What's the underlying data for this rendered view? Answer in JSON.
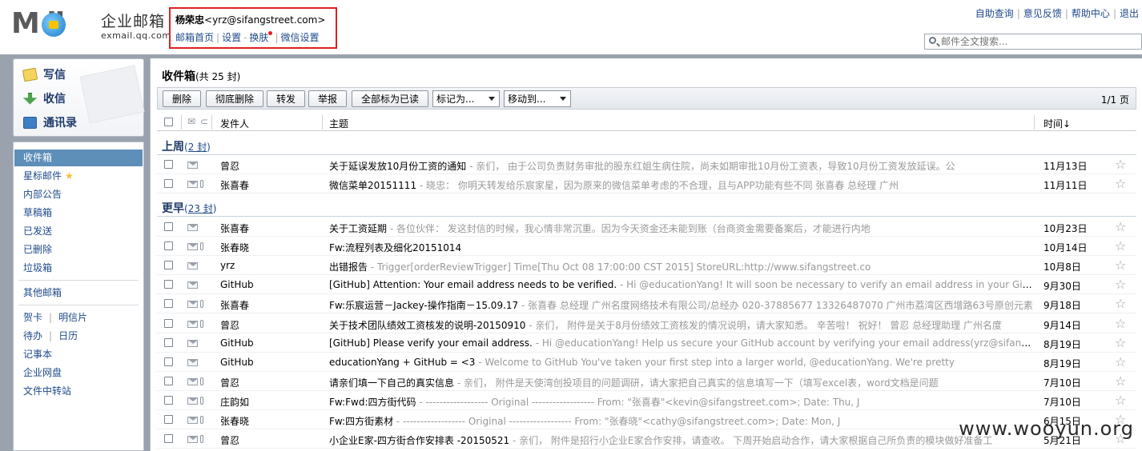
{
  "brand": {
    "logo_word": "M  il",
    "logo_cn": "企业邮箱",
    "logo_en": "exmail.qq.com"
  },
  "user": {
    "name": "杨荣忠",
    "email": "<yrz@sifangstreet.com>",
    "links": [
      "邮箱首页",
      "设置",
      "换肤",
      "微信设置"
    ]
  },
  "toplinks": [
    "自助查询",
    "意见反馈",
    "帮助中心",
    "退出"
  ],
  "search": {
    "placeholder": "邮件全文搜索..."
  },
  "actions": {
    "write": "写信",
    "receive": "收信",
    "contacts": "通讯录"
  },
  "folders": {
    "inbox": "收件箱",
    "starred": "星标邮件",
    "notice": "内部公告",
    "drafts": "草稿箱",
    "sent": "已发送",
    "deleted": "已删除",
    "spam": "垃圾箱",
    "other": "其他邮箱",
    "card": "贺卡",
    "postcard": "明信片",
    "todo": "待办",
    "calendar": "日历",
    "notes": "记事本",
    "disk": "企业网盘",
    "transfer": "文件中转站"
  },
  "main": {
    "title": "收件箱",
    "count": "(共 25 封)",
    "page": "1/1 页",
    "buttons": [
      "删除",
      "彻底删除",
      "转发",
      "举报",
      "全部标为已读"
    ],
    "mark_as": "标记为...",
    "move_to": "移动到...",
    "col_sender": "发件人",
    "col_subject": "主题",
    "col_time": "时间↓"
  },
  "groups": {
    "last_week": {
      "label": "上周",
      "count_open": "(",
      "count": "2 封",
      "count_close": ")"
    },
    "earlier": {
      "label": "更早",
      "count_open": "(",
      "count": "23 封",
      "count_close": ")"
    }
  },
  "mails_last_week": [
    {
      "sender": "曾忍",
      "subject": "关于延误发放10月份工资的通知",
      "snippet": " - 亲们， 由于公司负责财务审批的股东红姐生病住院，尚未如期审批10月份工资表，导致10月份工资发放延误。公",
      "date": "11月13日",
      "attach": false
    },
    {
      "sender": "张喜春",
      "subject": "微信菜单20151111",
      "snippet": " - 晓忠： 你明天转发给乐宸家星，因为原来的微信菜单考虑的不合理，且与APP功能有些不同 张喜春 总经理 广州",
      "date": "11月11日",
      "attach": true
    }
  ],
  "mails_earlier": [
    {
      "sender": "张喜春",
      "subject": "关于工资延期",
      "snippet": " - 各位伙伴： 发这封信的时候，我心情非常沉重。因为今天资金还未能到账（台商资金需要备案后，才能进行内地",
      "date": "10月23日",
      "attach": false
    },
    {
      "sender": "张春晓",
      "subject": "Fw:流程列表及细化20151014",
      "snippet": "",
      "date": "10月14日",
      "attach": true
    },
    {
      "sender": "yrz",
      "subject": "出错报告",
      "snippet": " - Trigger[orderReviewTrigger] Time[Thu Oct 08 17:00:00 CST 2015] StoreURL:http://www.sifangstreet.co",
      "date": "10月8日",
      "attach": false
    },
    {
      "sender": "GitHub",
      "subject": "[GitHub] Attention: Your email address needs to be verified.",
      "snippet": " - Hi @educationYang! It will soon be necessary to verify an email address in your GitHub account",
      "date": "9月30日",
      "attach": false
    },
    {
      "sender": "张喜春",
      "subject": "Fw:乐宸运营－Jackey-操作指南－15.09.17",
      "snippet": " - 张喜春 总经理 广州名度网络技术有限公司/总经办 020-37885677 13326487070 广州市荔湾区西增路63号原创元素",
      "date": "9月18日",
      "attach": true
    },
    {
      "sender": "曾忍",
      "subject": "关于技术团队绩效工资核发的说明-20150910",
      "snippet": " - 亲们， 附件是关于8月份绩效工资核发的情况说明，请大家知悉。 辛苦啦！ 祝好！ 曾忍 总经理助理 广州名度",
      "date": "9月14日",
      "attach": true
    },
    {
      "sender": "GitHub",
      "subject": "[GitHub] Please verify your email address.",
      "snippet": " - Hi @educationYang! Help us secure your GitHub account by verifying your email address(yrz@sifangstreet.com)",
      "date": "8月19日",
      "attach": false
    },
    {
      "sender": "GitHub",
      "subject": "educationYang + GitHub = <3",
      "snippet": " - Welcome to GitHub You've taken your first step into a larger world, @educationYang. We're pretty",
      "date": "8月19日",
      "attach": false
    },
    {
      "sender": "曾忍",
      "subject": "请亲们填一下自己的真实信息",
      "snippet": " - 亲们， 附件是天使湾创投项目的问题调研，请大家把自己真实的信息填写一下（填写excel表，word文档是问题",
      "date": "7月10日",
      "attach": true
    },
    {
      "sender": "庄韵如",
      "subject": "Fw:Fwd:四方街代码",
      "snippet": " - ------------------ Original ------------------ From: \"张喜春\"<kevin@sifangstreet.com>; Date: Thu, J",
      "date": "7月10日",
      "attach": true
    },
    {
      "sender": "张春晓",
      "subject": "Fw:四方街素材",
      "snippet": " - ------------------ Original ------------------ From: \"张春晓\"<cathy@sifangstreet.com>; Date: Mon, J",
      "date": "6月15日",
      "attach": true
    },
    {
      "sender": "曾忍",
      "subject": "小企业E家-四方街合作安排表 -20150521",
      "snippet": " - 亲们， 附件是招行小企业E家合作安排，请查收。 下周开始启动合作，请大家根据自己所负责的模块做好准备工",
      "date": "5月21日",
      "attach": true
    }
  ],
  "watermark": "www.wooyun.org"
}
